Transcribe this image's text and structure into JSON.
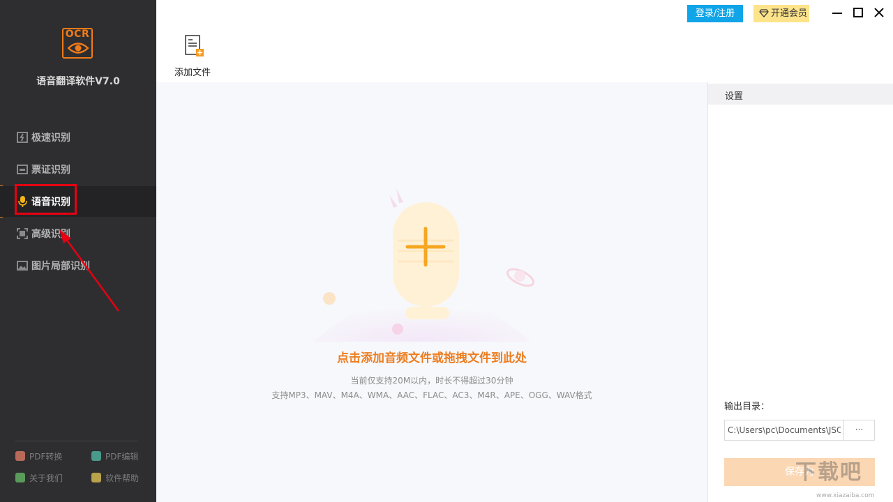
{
  "app": {
    "logo_text": "OCR",
    "title": "语音翻译软件V7.0"
  },
  "sidebar": {
    "items": [
      {
        "label": "极速识别",
        "icon": "fast-recognize-icon"
      },
      {
        "label": "票证识别",
        "icon": "ticket-recognize-icon"
      },
      {
        "label": "语音识别",
        "icon": "microphone-icon",
        "active": true
      },
      {
        "label": "高级识别",
        "icon": "advanced-recognize-icon"
      },
      {
        "label": "图片局部识别",
        "icon": "image-partial-icon"
      }
    ],
    "footer": [
      {
        "label": "PDF转换",
        "icon": "pdf-convert-icon"
      },
      {
        "label": "PDF编辑",
        "icon": "pdf-edit-icon"
      },
      {
        "label": "关于我们",
        "icon": "about-icon"
      },
      {
        "label": "软件帮助",
        "icon": "help-icon"
      }
    ]
  },
  "topbar": {
    "login_label": "登录/注册",
    "vip_label": "开通会员"
  },
  "toolbar": {
    "add_file_label": "添加文件"
  },
  "dropzone": {
    "title": "点击添加音频文件或拖拽文件到此处",
    "note": "当前仅支持20M以内，时长不得超过30分钟",
    "formats": "支持MP3、MAV、M4A、WMA、AAC、FLAC、AC3、M4R、APE、OGG、WAV格式"
  },
  "settings": {
    "title": "设置",
    "output_label": "输出目录：",
    "output_path": "C:\\Users\\pc\\Documents\\JSO",
    "browse_label": "···",
    "save_label": "保存为"
  },
  "watermark": {
    "text": "下载吧",
    "url": "www.xiazaiba.com"
  },
  "colors": {
    "accent": "#f07b19",
    "sidebar_bg": "#2e2e31",
    "login_blue": "#10a4e8",
    "vip_yellow": "#fde38a",
    "highlight_red": "#e60012"
  }
}
